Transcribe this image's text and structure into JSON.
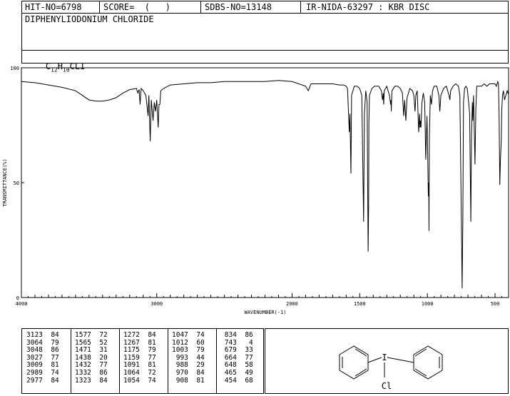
{
  "header": {
    "hit_no": "HIT-NO=6798",
    "score": "SCORE=  (   )",
    "sdbs_no": "SDBS-NO=13148",
    "ir_info": "IR-NIDA-63297 : KBR DISC"
  },
  "compound": {
    "name": "DIPHENYLIODONIUM CHLORIDE",
    "formula": {
      "c": "C",
      "c_n": "12",
      "h": "H",
      "h_n": "10",
      "rest": "CLI"
    }
  },
  "structure_labels": {
    "iodine": "I",
    "chlorine": "Cl"
  },
  "peak_table": {
    "columns": [
      [
        [
          "3123",
          "84"
        ],
        [
          "3064",
          "79"
        ],
        [
          "3048",
          "86"
        ],
        [
          "3027",
          "77"
        ],
        [
          "3009",
          "81"
        ],
        [
          "2989",
          "74"
        ],
        [
          "2977",
          "84"
        ]
      ],
      [
        [
          "1577",
          "72"
        ],
        [
          "1565",
          "52"
        ],
        [
          "1471",
          "31"
        ],
        [
          "1438",
          "20"
        ],
        [
          "1432",
          "77"
        ],
        [
          "1332",
          "86"
        ],
        [
          "1323",
          "84"
        ]
      ],
      [
        [
          "1272",
          "84"
        ],
        [
          "1267",
          "81"
        ],
        [
          "1175",
          "79"
        ],
        [
          "1159",
          "77"
        ],
        [
          "1091",
          "81"
        ],
        [
          "1064",
          "72"
        ],
        [
          "1054",
          "74"
        ]
      ],
      [
        [
          "1047",
          "74"
        ],
        [
          "1012",
          "60"
        ],
        [
          "1003",
          "79"
        ],
        [
          "993",
          "44"
        ],
        [
          "988",
          "29"
        ],
        [
          "970",
          "84"
        ],
        [
          "908",
          "81"
        ]
      ],
      [
        [
          "834",
          "86"
        ],
        [
          "743",
          "4"
        ],
        [
          "679",
          "33"
        ],
        [
          "664",
          "77"
        ],
        [
          "648",
          "58"
        ],
        [
          "465",
          "49"
        ],
        [
          "454",
          "68"
        ]
      ]
    ]
  },
  "chart_data": {
    "type": "line",
    "title": "",
    "xlabel": "WAVENUMBER(-1)",
    "ylabel": "TRANSMITTANCE(%)",
    "xlim": [
      4000,
      400
    ],
    "ylim": [
      0,
      100
    ],
    "x_ticks": [
      4000,
      3000,
      2000,
      1500,
      1000,
      500
    ],
    "y_ticks": [
      0,
      50,
      100
    ],
    "series": [
      {
        "points": [
          [
            4000,
            94
          ],
          [
            3900,
            93.5
          ],
          [
            3800,
            92.5
          ],
          [
            3700,
            91.5
          ],
          [
            3600,
            90
          ],
          [
            3500,
            86
          ],
          [
            3450,
            85.5
          ],
          [
            3400,
            85.5
          ],
          [
            3350,
            86
          ],
          [
            3300,
            87
          ],
          [
            3250,
            89
          ],
          [
            3200,
            90.5
          ],
          [
            3150,
            91
          ],
          [
            3140,
            89
          ],
          [
            3130,
            90.5
          ],
          [
            3123,
            84
          ],
          [
            3115,
            91
          ],
          [
            3100,
            90
          ],
          [
            3080,
            88
          ],
          [
            3064,
            79
          ],
          [
            3058,
            88
          ],
          [
            3048,
            68
          ],
          [
            3040,
            86
          ],
          [
            3027,
            77
          ],
          [
            3018,
            85
          ],
          [
            3009,
            81
          ],
          [
            3000,
            86
          ],
          [
            2989,
            74
          ],
          [
            2983,
            84
          ],
          [
            2977,
            84
          ],
          [
            2970,
            90
          ],
          [
            2950,
            91
          ],
          [
            2900,
            92.5
          ],
          [
            2800,
            93
          ],
          [
            2700,
            93.5
          ],
          [
            2600,
            93.5
          ],
          [
            2500,
            94
          ],
          [
            2400,
            94
          ],
          [
            2300,
            94
          ],
          [
            2200,
            94
          ],
          [
            2100,
            94.5
          ],
          [
            2000,
            94
          ],
          [
            1950,
            93
          ],
          [
            1900,
            92
          ],
          [
            1880,
            90
          ],
          [
            1860,
            93
          ],
          [
            1800,
            93
          ],
          [
            1750,
            93
          ],
          [
            1700,
            93
          ],
          [
            1650,
            92.5
          ],
          [
            1620,
            92.5
          ],
          [
            1600,
            92
          ],
          [
            1590,
            91
          ],
          [
            1577,
            72
          ],
          [
            1572,
            80
          ],
          [
            1565,
            54
          ],
          [
            1560,
            88
          ],
          [
            1540,
            92
          ],
          [
            1520,
            92
          ],
          [
            1500,
            91
          ],
          [
            1485,
            88
          ],
          [
            1471,
            33
          ],
          [
            1465,
            80
          ],
          [
            1455,
            90
          ],
          [
            1445,
            85
          ],
          [
            1438,
            20
          ],
          [
            1434,
            40
          ],
          [
            1432,
            77
          ],
          [
            1428,
            88
          ],
          [
            1410,
            91
          ],
          [
            1390,
            92
          ],
          [
            1360,
            92
          ],
          [
            1340,
            90
          ],
          [
            1332,
            86
          ],
          [
            1326,
            89
          ],
          [
            1323,
            84
          ],
          [
            1318,
            90
          ],
          [
            1300,
            92
          ],
          [
            1290,
            90
          ],
          [
            1280,
            88
          ],
          [
            1272,
            84
          ],
          [
            1268,
            86
          ],
          [
            1267,
            81
          ],
          [
            1262,
            90
          ],
          [
            1240,
            92
          ],
          [
            1220,
            92
          ],
          [
            1200,
            91
          ],
          [
            1185,
            89
          ],
          [
            1175,
            79
          ],
          [
            1168,
            86
          ],
          [
            1159,
            77
          ],
          [
            1150,
            87
          ],
          [
            1130,
            91
          ],
          [
            1110,
            90
          ],
          [
            1100,
            88
          ],
          [
            1091,
            81
          ],
          [
            1085,
            88
          ],
          [
            1075,
            90
          ],
          [
            1064,
            72
          ],
          [
            1058,
            80
          ],
          [
            1054,
            74
          ],
          [
            1050,
            77
          ],
          [
            1047,
            74
          ],
          [
            1040,
            85
          ],
          [
            1030,
            89
          ],
          [
            1020,
            85
          ],
          [
            1012,
            60
          ],
          [
            1007,
            70
          ],
          [
            1003,
            79
          ],
          [
            998,
            65
          ],
          [
            993,
            44
          ],
          [
            990,
            50
          ],
          [
            988,
            29
          ],
          [
            985,
            70
          ],
          [
            978,
            88
          ],
          [
            970,
            84
          ],
          [
            962,
            90
          ],
          [
            950,
            92
          ],
          [
            930,
            92
          ],
          [
            915,
            88
          ],
          [
            908,
            81
          ],
          [
            900,
            88
          ],
          [
            880,
            91
          ],
          [
            860,
            92
          ],
          [
            850,
            90
          ],
          [
            840,
            88
          ],
          [
            834,
            86
          ],
          [
            828,
            90
          ],
          [
            810,
            92
          ],
          [
            790,
            93
          ],
          [
            770,
            92
          ],
          [
            760,
            88
          ],
          [
            750,
            40
          ],
          [
            743,
            4
          ],
          [
            738,
            35
          ],
          [
            733,
            85
          ],
          [
            725,
            91
          ],
          [
            715,
            92
          ],
          [
            705,
            91
          ],
          [
            695,
            85
          ],
          [
            688,
            80
          ],
          [
            679,
            33
          ],
          [
            674,
            70
          ],
          [
            668,
            85
          ],
          [
            664,
            77
          ],
          [
            659,
            88
          ],
          [
            648,
            58
          ],
          [
            642,
            82
          ],
          [
            635,
            92
          ],
          [
            620,
            92
          ],
          [
            600,
            92
          ],
          [
            580,
            93
          ],
          [
            560,
            92
          ],
          [
            540,
            93
          ],
          [
            520,
            93
          ],
          [
            500,
            93
          ],
          [
            490,
            92
          ],
          [
            480,
            94
          ],
          [
            475,
            93
          ],
          [
            470,
            80
          ],
          [
            465,
            49
          ],
          [
            460,
            60
          ],
          [
            454,
            68
          ],
          [
            450,
            82
          ],
          [
            445,
            88
          ],
          [
            438,
            90
          ],
          [
            430,
            86
          ],
          [
            420,
            88
          ],
          [
            410,
            90
          ],
          [
            405,
            89
          ],
          [
            400,
            90
          ]
        ]
      }
    ]
  }
}
